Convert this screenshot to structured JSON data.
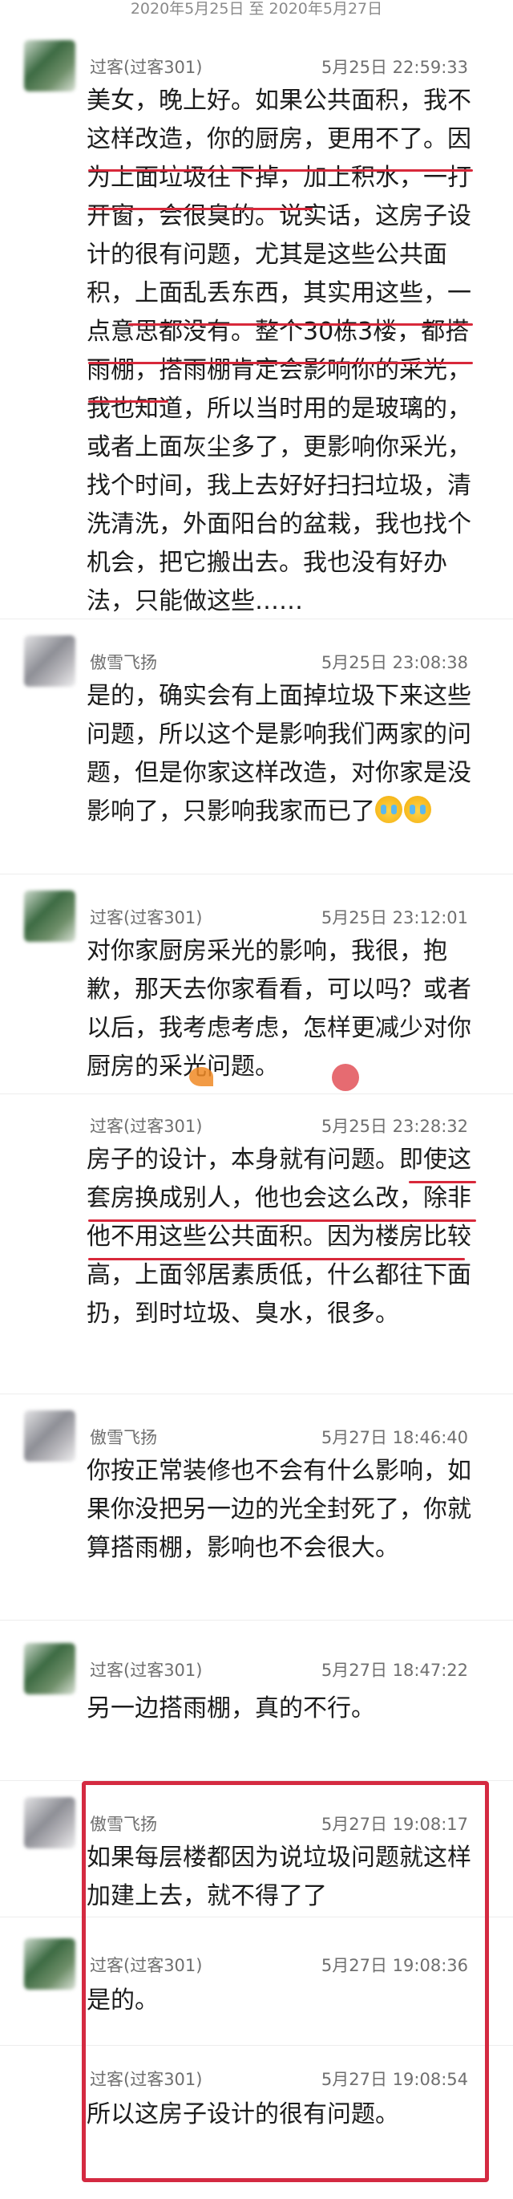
{
  "date_range": "2020年5月25日 至 2020年5月27日",
  "colors": {
    "annotation_red": "#d42a41",
    "meta_text": "#6f6f6f",
    "body_text": "#1c1c1c"
  },
  "messages": [
    {
      "sender": "过客(过客301)",
      "time": "5月25日 22:59:33",
      "avatar": "blurred-green-avatar",
      "text": "美女，晚上好。如果公共面积，我不这样改造，你的厨房，更用不了。因为上面垃圾往下掉，加上积水，一打开窗，会很臭的。说实话，这房子设计的很有问题，尤其是这些公共面积，上面乱丢东西，其实用这些，一点意思都没有。整个30栋3楼，都搭雨棚，搭雨棚肯定会影响你的采光，我也知道，所以当时用的是玻璃的，或者上面灰尘多了，更影响你采光，找个时间，我上去好好扫扫垃圾，清洗清洗，外面阳台的盆栽，我也找个机会，把它搬出去。我也没有好办法，只能做这些……"
    },
    {
      "sender": "傲雪飞扬",
      "time": "5月25日 23:08:38",
      "avatar": "blurred-grey-avatar",
      "text": "是的，确实会有上面掉垃圾下来这些问题，所以这个是影响我们两家的问题，但是你家这样改造，对你家是没影响了，只影响我家而已了"
    },
    {
      "sender": "过客(过客301)",
      "time": "5月25日 23:12:01",
      "avatar": "blurred-green-avatar",
      "text": "对你家厨房采光的影响，我很，抱歉，那天去你家看看，可以吗？或者以后，我考虑考虑，怎样更减少对你厨房的采光问题。"
    },
    {
      "sender": "过客(过客301)",
      "time": "5月25日 23:28:32",
      "avatar": "none",
      "text": "房子的设计，本身就有问题。即使这套房换成别人，他也会这么改，除非他不用这些公共面积。因为楼房比较高，上面邻居素质低，什么都往下面扔，到时垃圾、臭水，很多。"
    },
    {
      "sender": "傲雪飞扬",
      "time": "5月27日 18:46:40",
      "avatar": "blurred-grey-avatar",
      "text": "你按正常装修也不会有什么影响，如果你没把另一边的光全封死了，你就算搭雨棚，影响也不会很大。"
    },
    {
      "sender": "过客(过客301)",
      "time": "5月27日 18:47:22",
      "avatar": "blurred-green-avatar",
      "text": "另一边搭雨棚，真的不行。"
    },
    {
      "sender": "傲雪飞扬",
      "time": "5月27日 19:08:17",
      "avatar": "blurred-grey-avatar",
      "text": "如果每层楼都因为说垃圾问题就这样加建上去，就不得了了"
    },
    {
      "sender": "过客(过客301)",
      "time": "5月27日 19:08:36",
      "avatar": "blurred-green-avatar",
      "text": "是的。"
    },
    {
      "sender": "过客(过客301)",
      "time": "5月27日 19:08:54",
      "avatar": "none",
      "text": "所以这房子设计的很有问题。"
    }
  ]
}
